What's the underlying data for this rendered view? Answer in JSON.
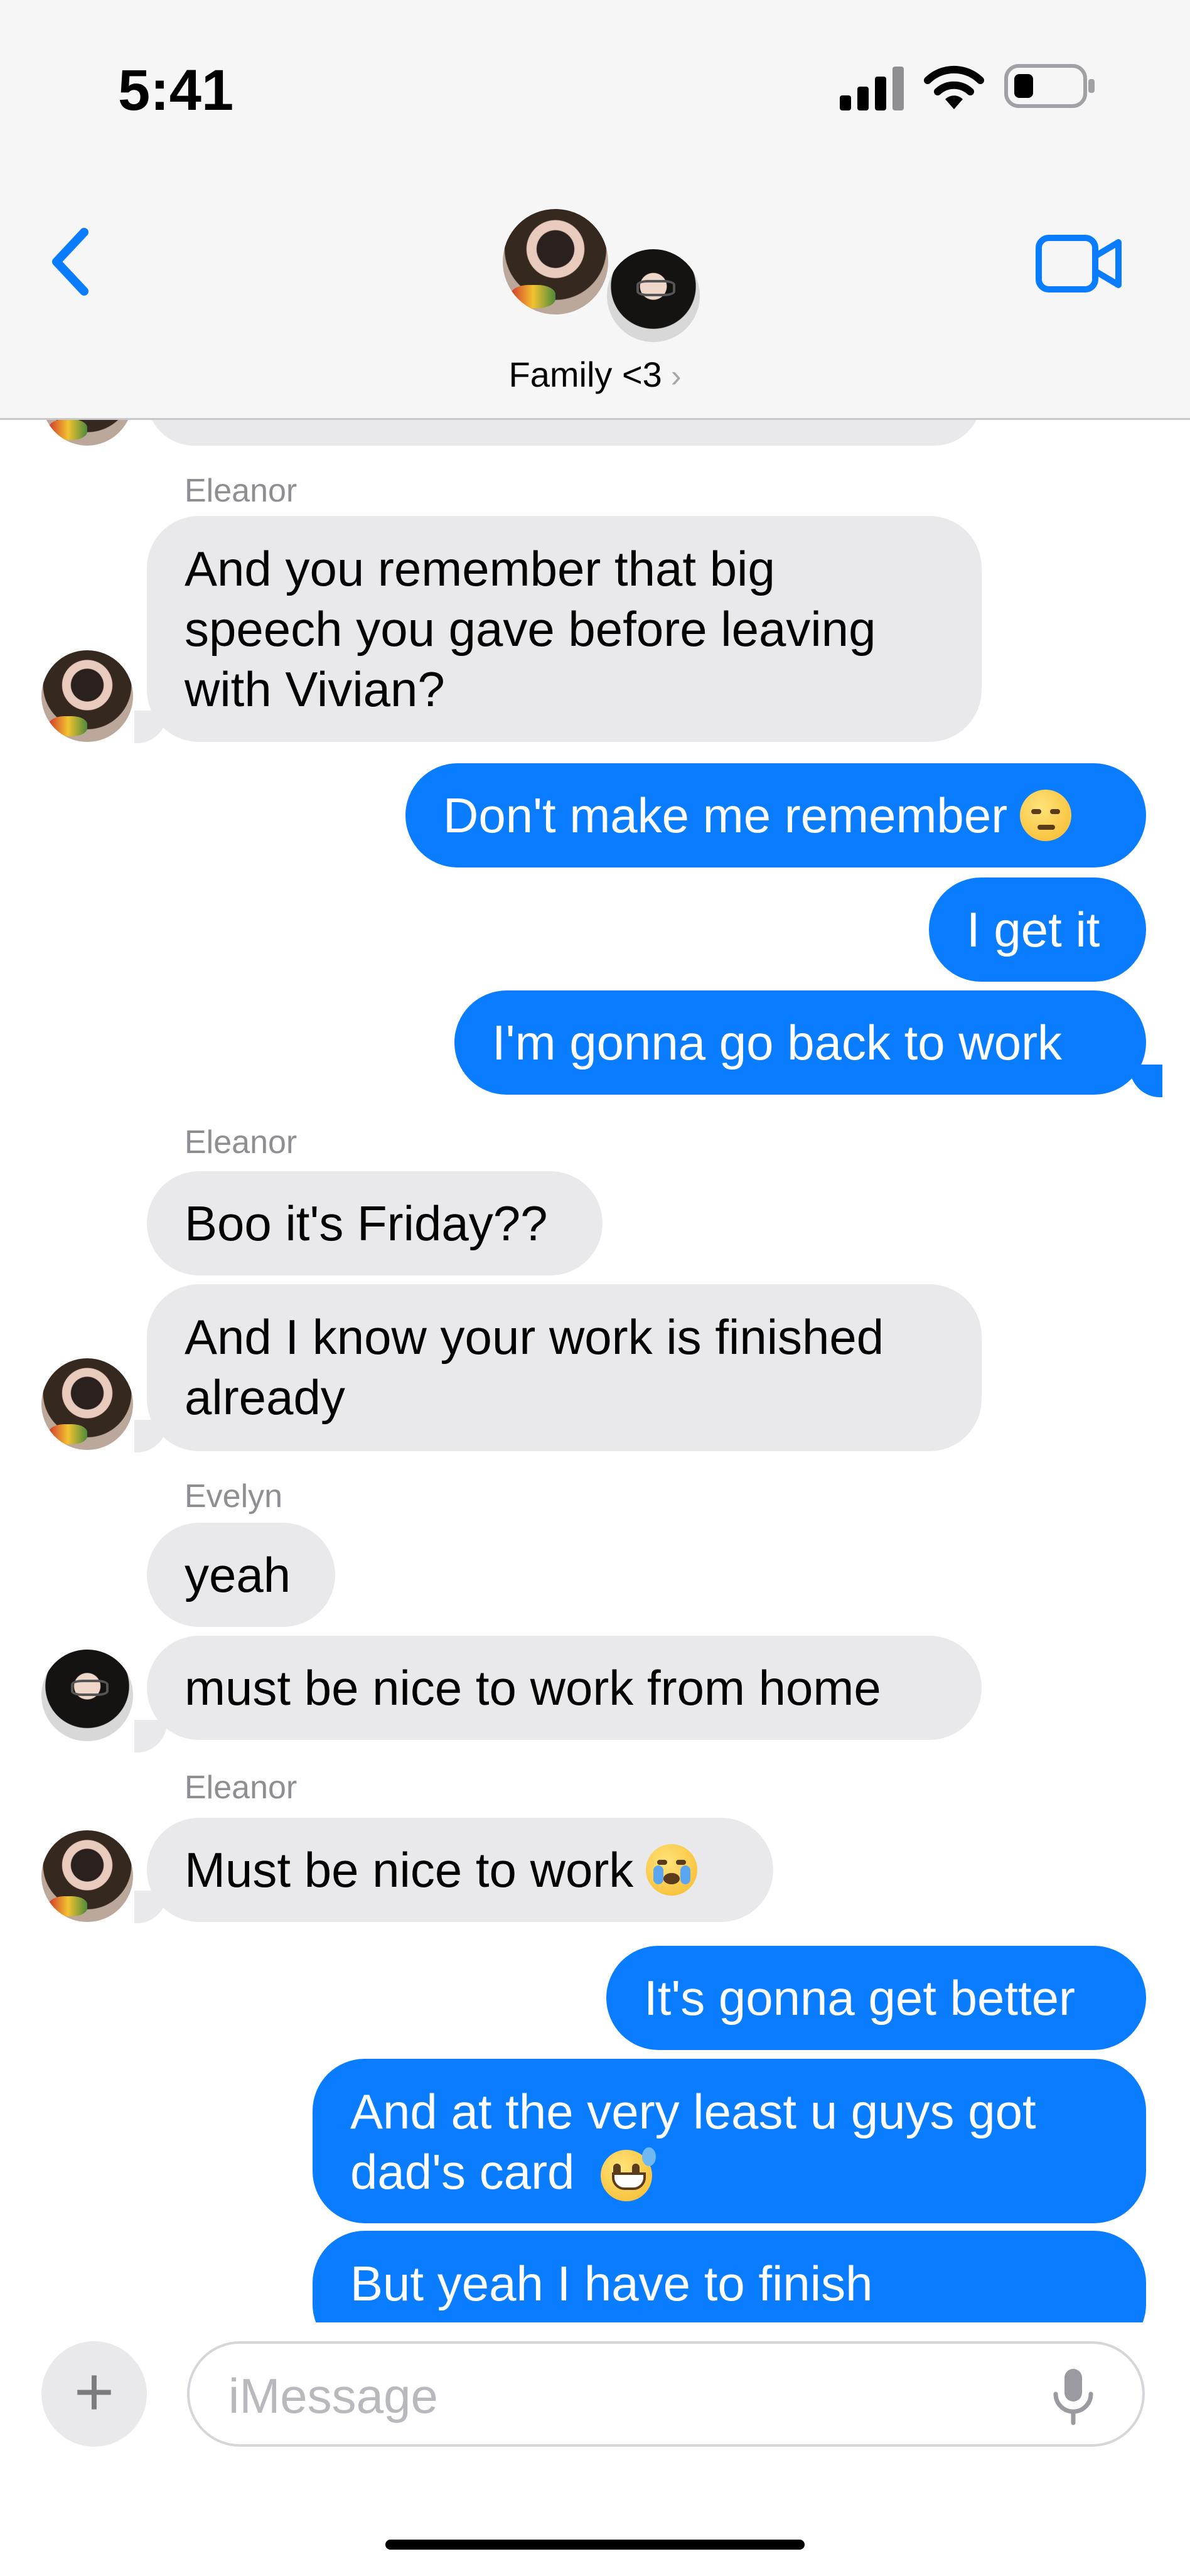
{
  "status_bar": {
    "time": "5:41"
  },
  "header": {
    "group_name": "Family <3",
    "chevron": "›"
  },
  "messages": {
    "m1": {
      "sender": "Eleanor",
      "text": "And you remember that big speech you gave before leaving with Vivian?"
    },
    "m2": {
      "text": "Don't make me remember",
      "emoji": "unamused-face"
    },
    "m3": {
      "text": "I get it"
    },
    "m4": {
      "text": "I'm gonna go back to work"
    },
    "m5": {
      "sender": "Eleanor",
      "text": "Boo it's Friday??"
    },
    "m6": {
      "text": "And I know your work is finished already"
    },
    "m7": {
      "sender": "Evelyn",
      "text": "yeah"
    },
    "m8": {
      "text": "must be nice to work from home"
    },
    "m9": {
      "sender": "Eleanor",
      "text": "Must be nice to work",
      "emoji": "loudly-crying-face"
    },
    "m10": {
      "text": "It's gonna get better"
    },
    "m11": {
      "text": "And at the very least u guys got dad's card",
      "emoji": "grinning-face-with-sweat"
    },
    "m12": {
      "text": "But yeah I have to finish"
    }
  },
  "composer": {
    "plus": "+",
    "placeholder": "iMessage"
  },
  "colors": {
    "blue": "#0a7cff",
    "gray_bubble": "#e9e9eb",
    "header_bg": "#f6f6f6"
  }
}
